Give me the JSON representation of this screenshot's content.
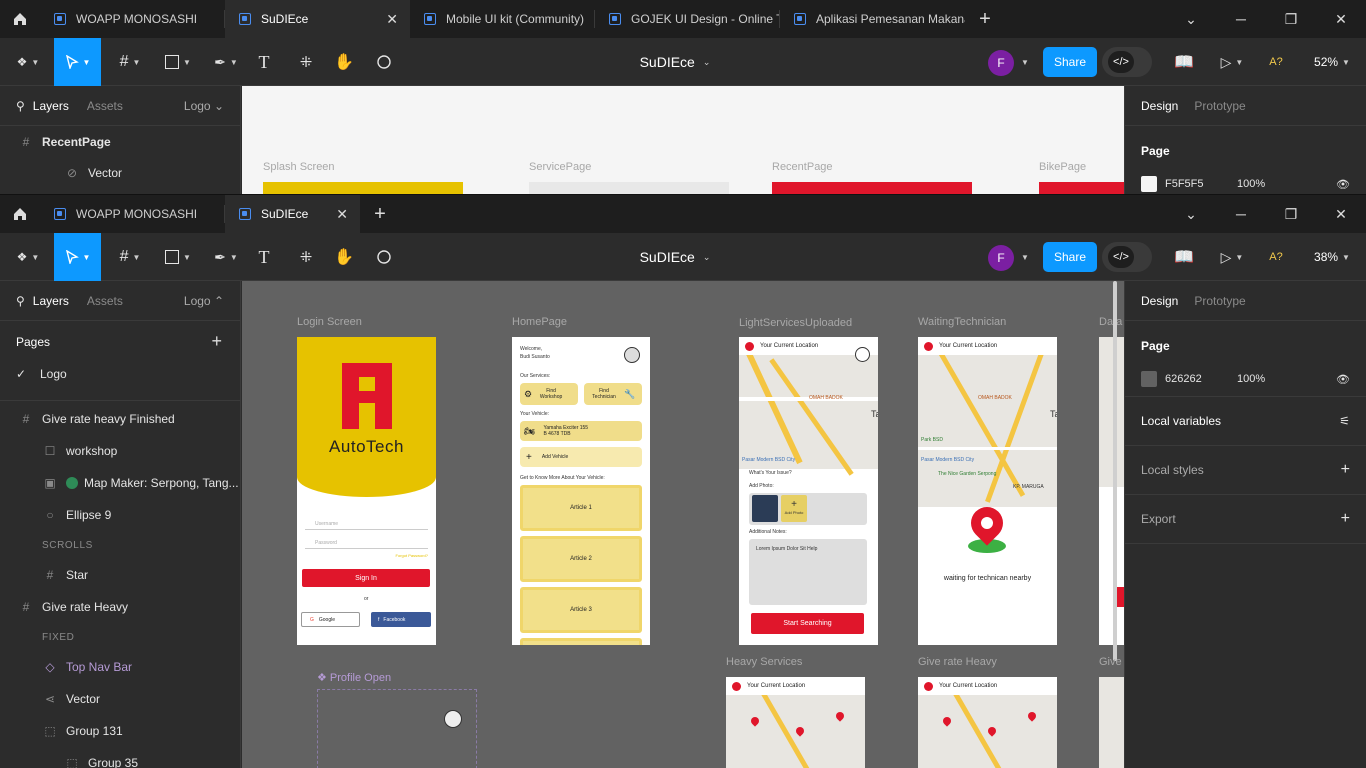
{
  "win1": {
    "tabs": [
      "WOAPP MONOSASHI",
      "SuDIEce",
      "Mobile UI kit (Community)",
      "GOJEK UI Design - Online Tra",
      "Aplikasi Pemesanan Makanan"
    ],
    "file_name": "SuDIEce",
    "avatar": "F",
    "share": "Share",
    "zoom": "52%",
    "left_tabs": {
      "layers": "Layers",
      "assets": "Assets",
      "page": "Logo"
    },
    "layers": [
      "RecentPage",
      "Vector"
    ],
    "right_tabs": {
      "design": "Design",
      "prototype": "Prototype"
    },
    "page_label": "Page",
    "page_color": "F5F5F5",
    "page_opacity": "100%",
    "canvas_labels": [
      "Splash Screen",
      "ServicePage",
      "RecentPage",
      "BikePage"
    ]
  },
  "win2": {
    "tabs": [
      "WOAPP MONOSASHI",
      "SuDIEce"
    ],
    "file_name": "SuDIEce",
    "avatar": "F",
    "share": "Share",
    "zoom": "38%",
    "left_tabs": {
      "layers": "Layers",
      "assets": "Assets",
      "page": "Logo"
    },
    "pages_title": "Pages",
    "pages": [
      "Logo"
    ],
    "layers": [
      {
        "name": "Give rate heavy Finished",
        "icon": "#",
        "indent": 0
      },
      {
        "name": "workshop",
        "icon": "☐",
        "indent": 1
      },
      {
        "name": "Map Maker: Serpong, Tang...",
        "icon": "img",
        "indent": 1
      },
      {
        "name": "Ellipse 9",
        "icon": "○",
        "indent": 1
      },
      {
        "name": "SCROLLS",
        "icon": "",
        "indent": 1,
        "section": true
      },
      {
        "name": "Star",
        "icon": "#",
        "indent": 1
      },
      {
        "name": "Give rate Heavy",
        "icon": "#",
        "indent": 0
      },
      {
        "name": "FIXED",
        "icon": "",
        "indent": 1,
        "section": true
      },
      {
        "name": "Top Nav Bar",
        "icon": "◇",
        "indent": 1,
        "component": true
      },
      {
        "name": "Vector",
        "icon": "⋖",
        "indent": 1
      },
      {
        "name": "Group 131",
        "icon": "⬚",
        "indent": 1
      },
      {
        "name": "Group 35",
        "icon": "⬚",
        "indent": 2
      }
    ],
    "right_tabs": {
      "design": "Design",
      "prototype": "Prototype"
    },
    "page_label": "Page",
    "page_color": "626262",
    "page_opacity": "100%",
    "local_variables": "Local variables",
    "local_styles": "Local styles",
    "export": "Export",
    "frames": {
      "login": {
        "label": "Login Screen",
        "brand": "AutoTech",
        "username": "Username",
        "password": "Password",
        "forgot": "Forgot Password?",
        "sign_in": "Sign In",
        "or": "or",
        "google": "Google",
        "facebook": "Facebook"
      },
      "home": {
        "label": "HomePage",
        "welcome": "Welcome,",
        "user": "Budi Susanto",
        "services": "Our Services:",
        "find_workshop": "Find Workshop",
        "find_technician": "Find Technician",
        "your_vehicle": "Your Vehicle:",
        "vehicle_name": "Yamaha Exciter 155",
        "vehicle_plate": "B 4678 TDB",
        "add_vehicle": "Add Vehicle",
        "know_more": "Get to Know More About Your Vehicle:",
        "articles": [
          "Article 1",
          "Article 2",
          "Article 3"
        ]
      },
      "light": {
        "label": "LightServicesUploaded",
        "location": "Your Current Location",
        "issue": "What's Your Issue?",
        "add_photo": "Add Photo:",
        "add_photo_btn": "Add Photo",
        "notes": "Additional Notes:",
        "notes_text": "Lorem Ipsum Dolor Sit Help",
        "start": "Start Searching",
        "map_labels": [
          "OMAH BADOK",
          "Pasar Modern BSD City",
          "Ta"
        ]
      },
      "waiting": {
        "label": "WaitingTechnician",
        "location": "Your Current Location",
        "message": "waiting for technican nearby",
        "map_labels": [
          "OMAH BADOK",
          "Park BSD",
          "Pasar Modern BSD City",
          "The Nice Garden Serpong",
          "KP. MARUGA",
          "Ta"
        ]
      },
      "data_label": "Data",
      "heavy": {
        "label": "Heavy Services",
        "location": "Your Current Location"
      },
      "give_rate": {
        "label": "Give rate Heavy",
        "location": "Your Current Location"
      },
      "give_label": "Give",
      "profile": {
        "label": "Profile Open"
      }
    }
  },
  "colors": {
    "accent": "#0d99ff",
    "brand_red": "#e0162b",
    "brand_yellow": "#e6c200",
    "canvas2": "#626262",
    "canvas1": "#f5f5f5"
  }
}
